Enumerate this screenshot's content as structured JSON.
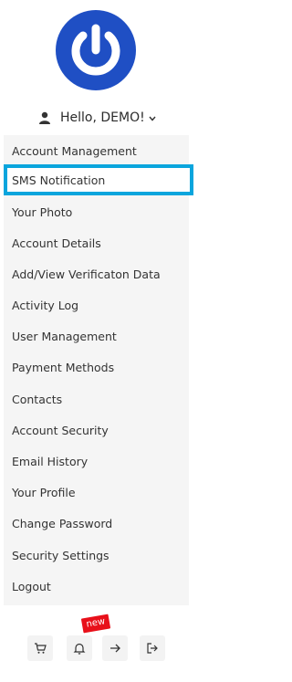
{
  "user": {
    "greeting": "Hello, DEMO!"
  },
  "menu": {
    "items": [
      {
        "label": "Account Management"
      },
      {
        "label": "SMS Notification"
      },
      {
        "label": "Your Photo"
      },
      {
        "label": "Account Details"
      },
      {
        "label": "Add/View Verificaton Data"
      },
      {
        "label": "Activity Log"
      },
      {
        "label": "User Management"
      },
      {
        "label": "Payment Methods"
      },
      {
        "label": "Contacts"
      },
      {
        "label": "Account Security"
      },
      {
        "label": "Email History"
      },
      {
        "label": "Your Profile"
      },
      {
        "label": "Change Password"
      },
      {
        "label": "Security Settings"
      },
      {
        "label": "Logout"
      }
    ],
    "active_item": "SMS Notification"
  },
  "bottom_bar": {
    "buttons": [
      {
        "icon": "cart-icon"
      },
      {
        "icon": "bell-icon"
      },
      {
        "icon": "arrow-right-icon"
      },
      {
        "icon": "logout-icon"
      }
    ],
    "badge": "new"
  },
  "colors": {
    "logo_blue": "#1f4fc4",
    "highlight": "#0aa5dd",
    "badge_red": "#e8101a",
    "menu_bg": "#f5f5f5"
  }
}
